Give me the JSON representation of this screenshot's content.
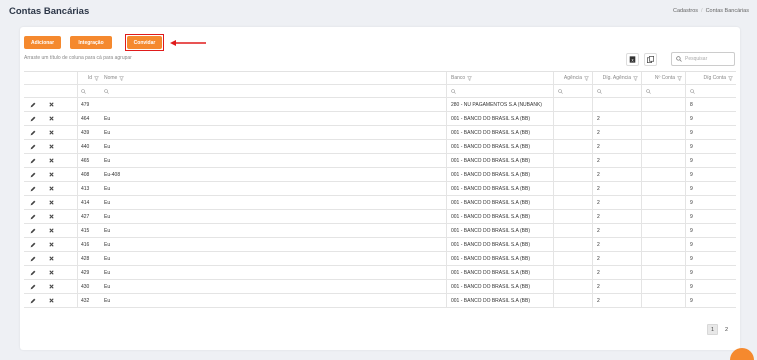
{
  "header": {
    "title": "Contas Bancárias",
    "breadcrumb": [
      "Cadastros",
      "Contas Bancárias"
    ]
  },
  "toolbar": {
    "adicionar_label": "Adicionar",
    "integracao_label": "Integração",
    "convidar_label": "Convidar",
    "group_hint": "Arraste um título de coluna para cá para agrupar",
    "search_placeholder": "Pesquisar"
  },
  "colors": {
    "accent": "#f5892e",
    "highlight": "#e01b1b"
  },
  "table": {
    "columns": {
      "id": "Id",
      "nome": "Nome",
      "banco": "Banco",
      "agencia": "Agência",
      "dig_agencia": "Díg. Agência",
      "num_conta": "Nº Conta",
      "dig_conta": "Díg Conta"
    },
    "rows": [
      {
        "id": "479",
        "nome": "",
        "banco": "280 - NU PAGAMENTOS S.A (NUBANK)",
        "agencia": "",
        "dig_agencia": "",
        "num_conta": "",
        "dig_conta": "8"
      },
      {
        "id": "464",
        "nome": "Eu",
        "banco": "001 - BANCO DO BRASIL S.A (BB)",
        "agencia": "",
        "dig_agencia": "2",
        "num_conta": "",
        "dig_conta": "9"
      },
      {
        "id": "439",
        "nome": "Eu",
        "banco": "001 - BANCO DO BRASIL S.A (BB)",
        "agencia": "",
        "dig_agencia": "2",
        "num_conta": "",
        "dig_conta": "9"
      },
      {
        "id": "440",
        "nome": "Eu",
        "banco": "001 - BANCO DO BRASIL S.A (BB)",
        "agencia": "",
        "dig_agencia": "2",
        "num_conta": "",
        "dig_conta": "9"
      },
      {
        "id": "465",
        "nome": "Eu",
        "banco": "001 - BANCO DO BRASIL S.A (BB)",
        "agencia": "",
        "dig_agencia": "2",
        "num_conta": "",
        "dig_conta": "9"
      },
      {
        "id": "408",
        "nome": "Eu-408",
        "banco": "001 - BANCO DO BRASIL S.A (BB)",
        "agencia": "",
        "dig_agencia": "2",
        "num_conta": "",
        "dig_conta": "9"
      },
      {
        "id": "413",
        "nome": "Eu",
        "banco": "001 - BANCO DO BRASIL S.A (BB)",
        "agencia": "",
        "dig_agencia": "2",
        "num_conta": "",
        "dig_conta": "9"
      },
      {
        "id": "414",
        "nome": "Eu",
        "banco": "001 - BANCO DO BRASIL S.A (BB)",
        "agencia": "",
        "dig_agencia": "2",
        "num_conta": "",
        "dig_conta": "9"
      },
      {
        "id": "427",
        "nome": "Eu",
        "banco": "001 - BANCO DO BRASIL S.A (BB)",
        "agencia": "",
        "dig_agencia": "2",
        "num_conta": "",
        "dig_conta": "9"
      },
      {
        "id": "415",
        "nome": "Eu",
        "banco": "001 - BANCO DO BRASIL S.A (BB)",
        "agencia": "",
        "dig_agencia": "2",
        "num_conta": "",
        "dig_conta": "9"
      },
      {
        "id": "416",
        "nome": "Eu",
        "banco": "001 - BANCO DO BRASIL S.A (BB)",
        "agencia": "",
        "dig_agencia": "2",
        "num_conta": "",
        "dig_conta": "9"
      },
      {
        "id": "428",
        "nome": "Eu",
        "banco": "001 - BANCO DO BRASIL S.A (BB)",
        "agencia": "",
        "dig_agencia": "2",
        "num_conta": "",
        "dig_conta": "9"
      },
      {
        "id": "429",
        "nome": "Eu",
        "banco": "001 - BANCO DO BRASIL S.A (BB)",
        "agencia": "",
        "dig_agencia": "2",
        "num_conta": "",
        "dig_conta": "9"
      },
      {
        "id": "430",
        "nome": "Eu",
        "banco": "001 - BANCO DO BRASIL S.A (BB)",
        "agencia": "",
        "dig_agencia": "2",
        "num_conta": "",
        "dig_conta": "9"
      },
      {
        "id": "432",
        "nome": "Eu",
        "banco": "001 - BANCO DO BRASIL S.A (BB)",
        "agencia": "",
        "dig_agencia": "2",
        "num_conta": "",
        "dig_conta": "9"
      }
    ]
  },
  "pagination": {
    "pages": [
      "1",
      "2"
    ],
    "current": "1"
  }
}
